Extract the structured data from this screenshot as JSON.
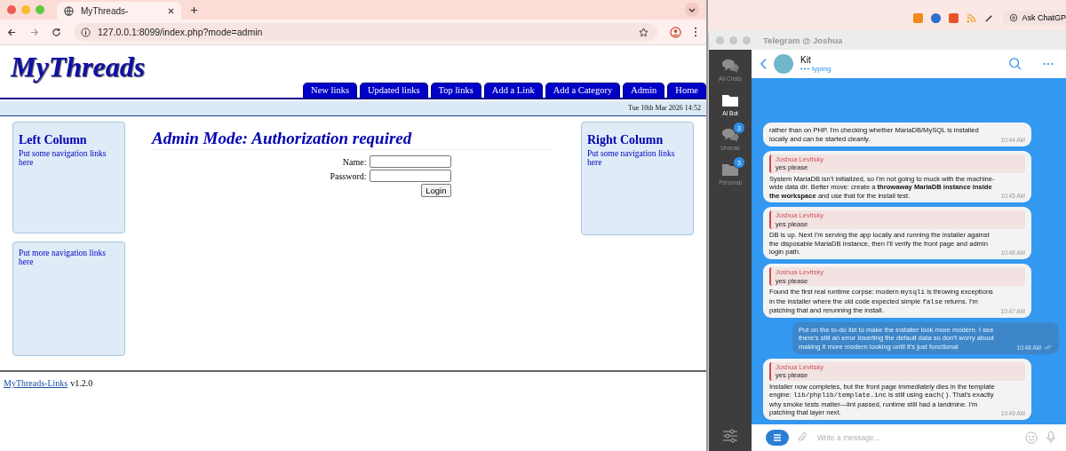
{
  "browser": {
    "tab": {
      "title": "MyThreads-",
      "selected": true
    },
    "address": {
      "value": "127.0.0.1:8099/index.php?mode=admin"
    },
    "page": {
      "site_title": "MyThreads",
      "nav": [
        {
          "label": "New links"
        },
        {
          "label": "Updated links"
        },
        {
          "label": "Top links"
        },
        {
          "label": "Add a Link"
        },
        {
          "label": "Add a Category"
        },
        {
          "label": "Admin"
        },
        {
          "label": "Home"
        }
      ],
      "date": "Tue 10th Mar 2026 14:52",
      "left_column": {
        "heading": "Left Column",
        "text": "Put some navigation links here"
      },
      "left_column_more": {
        "text": "Put more navigation links here"
      },
      "main": {
        "heading": "Admin Mode: Authorization required",
        "fields": [
          {
            "label": "Name:"
          },
          {
            "label": "Password:"
          }
        ],
        "submit": "Login"
      },
      "right_column": {
        "heading": "Right Column",
        "text": "Put some navigation links here"
      },
      "footer": {
        "link": "MyThreads-Links",
        "version": "v1.2.0"
      }
    }
  },
  "extensions": {
    "ask_button": "Ask ChatGP"
  },
  "telegram": {
    "window_title": "Telegram @ Joshua",
    "folders": [
      {
        "label": "All Chats",
        "kind": "chats",
        "selected": false
      },
      {
        "label": "AI Bot",
        "kind": "folder",
        "selected": true
      },
      {
        "label": "Unread",
        "kind": "chats",
        "badge": "3",
        "selected": false
      },
      {
        "label": "Personal",
        "kind": "folder",
        "badge": "3",
        "selected": false
      }
    ],
    "chat": {
      "name": "Kit",
      "status": "typing"
    },
    "messages": [
      {
        "kind": "incoming",
        "body": [
          {
            "kind": "text",
            "text": "rather than on PHP. I'm checking whether MariaDB/MySQL is installed locally and can be started cleanly."
          }
        ],
        "time": "10:44 AM"
      },
      {
        "kind": "incoming",
        "reply": {
          "author": "Joshua Levitsky",
          "text": "yes please"
        },
        "body": [
          {
            "kind": "text",
            "text": "System MariaDB isn't initialized, so I'm not going to muck with the machine-wide data dir. Better move: create a "
          },
          {
            "kind": "bold",
            "text": "throwaway MariaDB instance inside the workspace"
          },
          {
            "kind": "text",
            "text": " and use that for the install test."
          }
        ],
        "time": "10:45 AM"
      },
      {
        "kind": "incoming",
        "reply": {
          "author": "Joshua Levitsky",
          "text": "yes please"
        },
        "body": [
          {
            "kind": "text",
            "text": "DB is up. Next I'm serving the app locally and running the installer against the disposable MariaDB instance, then I'll verify the front page and admin login path."
          }
        ],
        "time": "10:46 AM"
      },
      {
        "kind": "incoming",
        "reply": {
          "author": "Joshua Levitsky",
          "text": "yes please"
        },
        "body": [
          {
            "kind": "text",
            "text": "Found the first real runtime corpse: modern "
          },
          {
            "kind": "code",
            "text": "mysqli"
          },
          {
            "kind": "text",
            "text": " is throwing exceptions in the installer where the old code expected simple "
          },
          {
            "kind": "code",
            "text": "false"
          },
          {
            "kind": "text",
            "text": " returns. I'm patching that and rerunning the install."
          }
        ],
        "time": "10:47 AM"
      },
      {
        "kind": "outgoing",
        "read": true,
        "body": [
          {
            "kind": "text",
            "text": "Put on the to-do list to make the installer look more modern. I see there's still an error inserting the default data so don't worry about making it more modern looking until it's just functional"
          }
        ],
        "time": "10:48 AM"
      },
      {
        "kind": "incoming",
        "reply": {
          "author": "Joshua Levitsky",
          "text": "yes please"
        },
        "body": [
          {
            "kind": "text",
            "text": "Installer now completes, but the front page immediately dies in the template engine: "
          },
          {
            "kind": "code",
            "text": "lib/phplib/template.inc"
          },
          {
            "kind": "text",
            "text": " is still using "
          },
          {
            "kind": "code",
            "text": "each()"
          },
          {
            "kind": "text",
            "text": ". That's exactly why smoke tests matter—lint passed, runtime still had a landmine. I'm patching that layer next."
          }
        ],
        "time": "10:49 AM"
      }
    ],
    "composer": {
      "placeholder": "Write a message..."
    }
  }
}
